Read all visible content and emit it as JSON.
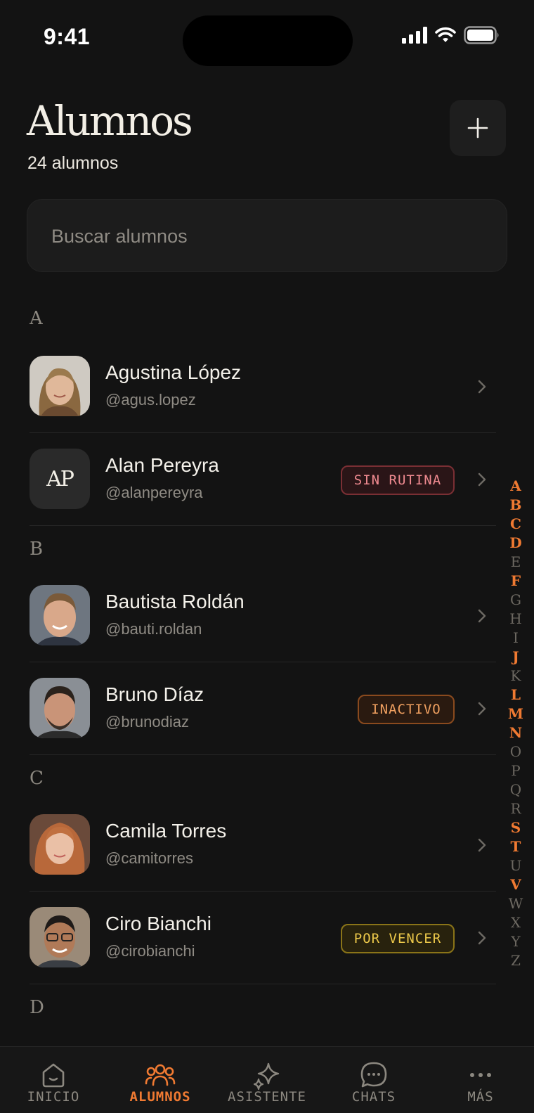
{
  "status_bar": {
    "time": "9:41"
  },
  "header": {
    "title": "Alumnos",
    "count": "24 alumnos",
    "add_icon": "plus-icon"
  },
  "search": {
    "placeholder": "Buscar alumnos",
    "value": ""
  },
  "sections": [
    {
      "letter": "A",
      "students": [
        {
          "name": "Agustina López",
          "handle": "@agus.lopez",
          "avatar": "photo",
          "badge": null
        },
        {
          "name": "Alan Pereyra",
          "handle": "@alanpereyra",
          "avatar": "initials",
          "initials": "AP",
          "badge": "SIN RUTINA",
          "badge_color": "#ef8a90"
        }
      ]
    },
    {
      "letter": "B",
      "students": [
        {
          "name": "Bautista Roldán",
          "handle": "@bauti.roldan",
          "avatar": "photo",
          "badge": null
        },
        {
          "name": "Bruno Díaz",
          "handle": "@brunodiaz",
          "avatar": "photo",
          "badge": "INACTIVO",
          "badge_color": "#f0a060"
        }
      ]
    },
    {
      "letter": "C",
      "students": [
        {
          "name": "Camila Torres",
          "handle": "@camitorres",
          "avatar": "photo",
          "badge": null
        },
        {
          "name": "Ciro Bianchi",
          "handle": "@cirobianchi",
          "avatar": "photo",
          "badge": "POR VENCER",
          "badge_color": "#ecc84a"
        }
      ]
    },
    {
      "letter": "D",
      "students": []
    }
  ],
  "alphabet_index": {
    "letters": [
      "A",
      "B",
      "C",
      "D",
      "E",
      "F",
      "G",
      "H",
      "I",
      "J",
      "K",
      "L",
      "M",
      "N",
      "O",
      "P",
      "Q",
      "R",
      "S",
      "T",
      "U",
      "V",
      "W",
      "X",
      "Y",
      "Z"
    ],
    "active": [
      "A",
      "B",
      "C",
      "D",
      "F",
      "J",
      "L",
      "M",
      "N",
      "S",
      "T",
      "V"
    ],
    "active_color": "#f07a32"
  },
  "tab_bar": {
    "tabs": [
      {
        "label": "INICIO",
        "icon": "home-icon"
      },
      {
        "label": "ALUMNOS",
        "icon": "users-icon",
        "active": true
      },
      {
        "label": "ASISTENTE",
        "icon": "sparkles-icon"
      },
      {
        "label": "CHATS",
        "icon": "chat-bubble-icon"
      },
      {
        "label": "MÁS",
        "icon": "more-dots-icon"
      }
    ]
  },
  "colors": {
    "background": "#131313",
    "accent": "#f07a32"
  }
}
